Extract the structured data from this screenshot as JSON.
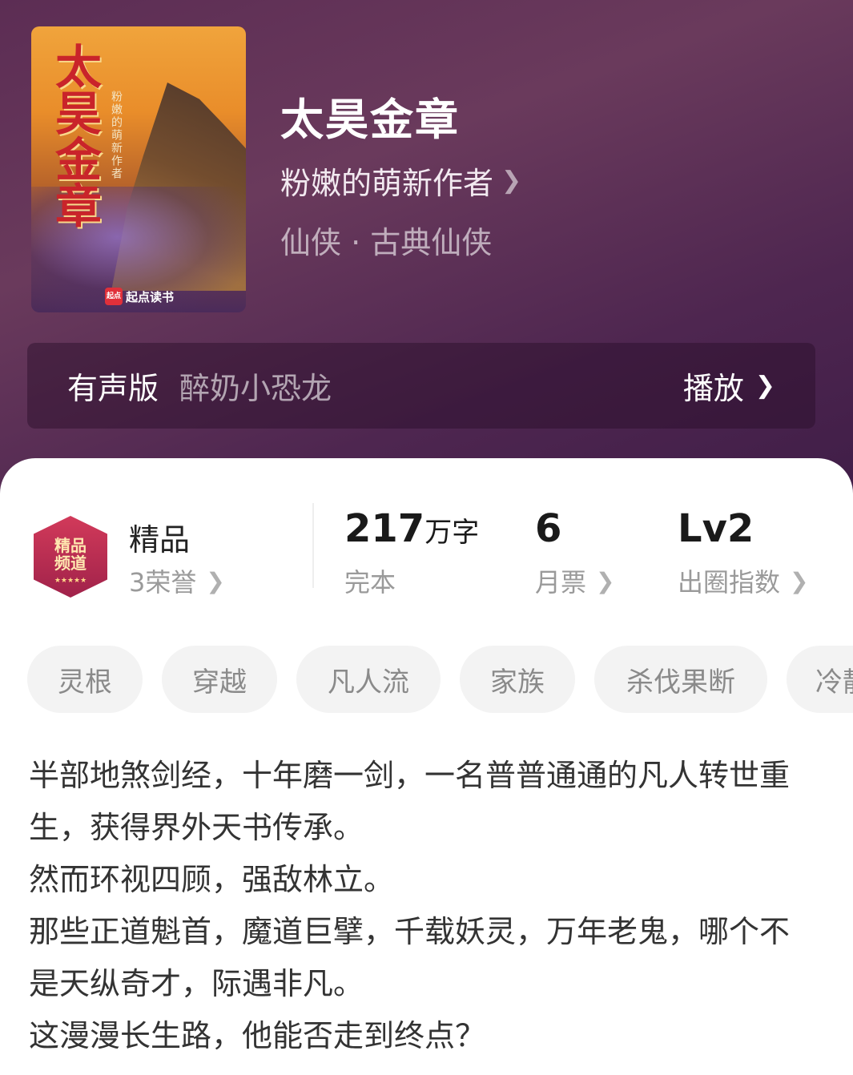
{
  "book": {
    "title": "太昊金章",
    "author": "粉嫩的萌新作者",
    "genre": "仙侠 · 古典仙侠",
    "cover": {
      "title": "太昊金章",
      "author": "粉嫩的萌新作者",
      "brand": "起点读书",
      "brand_logo": "起点"
    }
  },
  "audio": {
    "label": "有声版",
    "narrator": "醉奶小恐龙",
    "play_label": "播放"
  },
  "honor": {
    "badge_text": "精品频道",
    "badge_line1": "精品",
    "badge_line2": "频道",
    "title": "精品",
    "count": "3荣誉"
  },
  "stats": {
    "words_value": "217",
    "words_unit": "万字",
    "status": "完本",
    "monthly_tickets": "6",
    "monthly_label": "月票",
    "level": "Lv2",
    "level_label": "出圈指数"
  },
  "tags": [
    "灵根",
    "穿越",
    "凡人流",
    "家族",
    "杀伐果断",
    "冷静"
  ],
  "synopsis": [
    "半部地煞剑经，十年磨一剑，一名普普通通的凡人转世重生，获得界外天书传承。",
    "然而环视四顾，强敌林立。",
    "那些正道魁首，魔道巨擘，千载妖灵，万年老鬼，哪个不是天纵奇才，际遇非凡。",
    "这漫漫长生路，他能否走到终点？"
  ],
  "colors": {
    "header_bg": "#5c2d54",
    "accent_red": "#c9242a",
    "tag_bg": "#f3f3f3"
  }
}
